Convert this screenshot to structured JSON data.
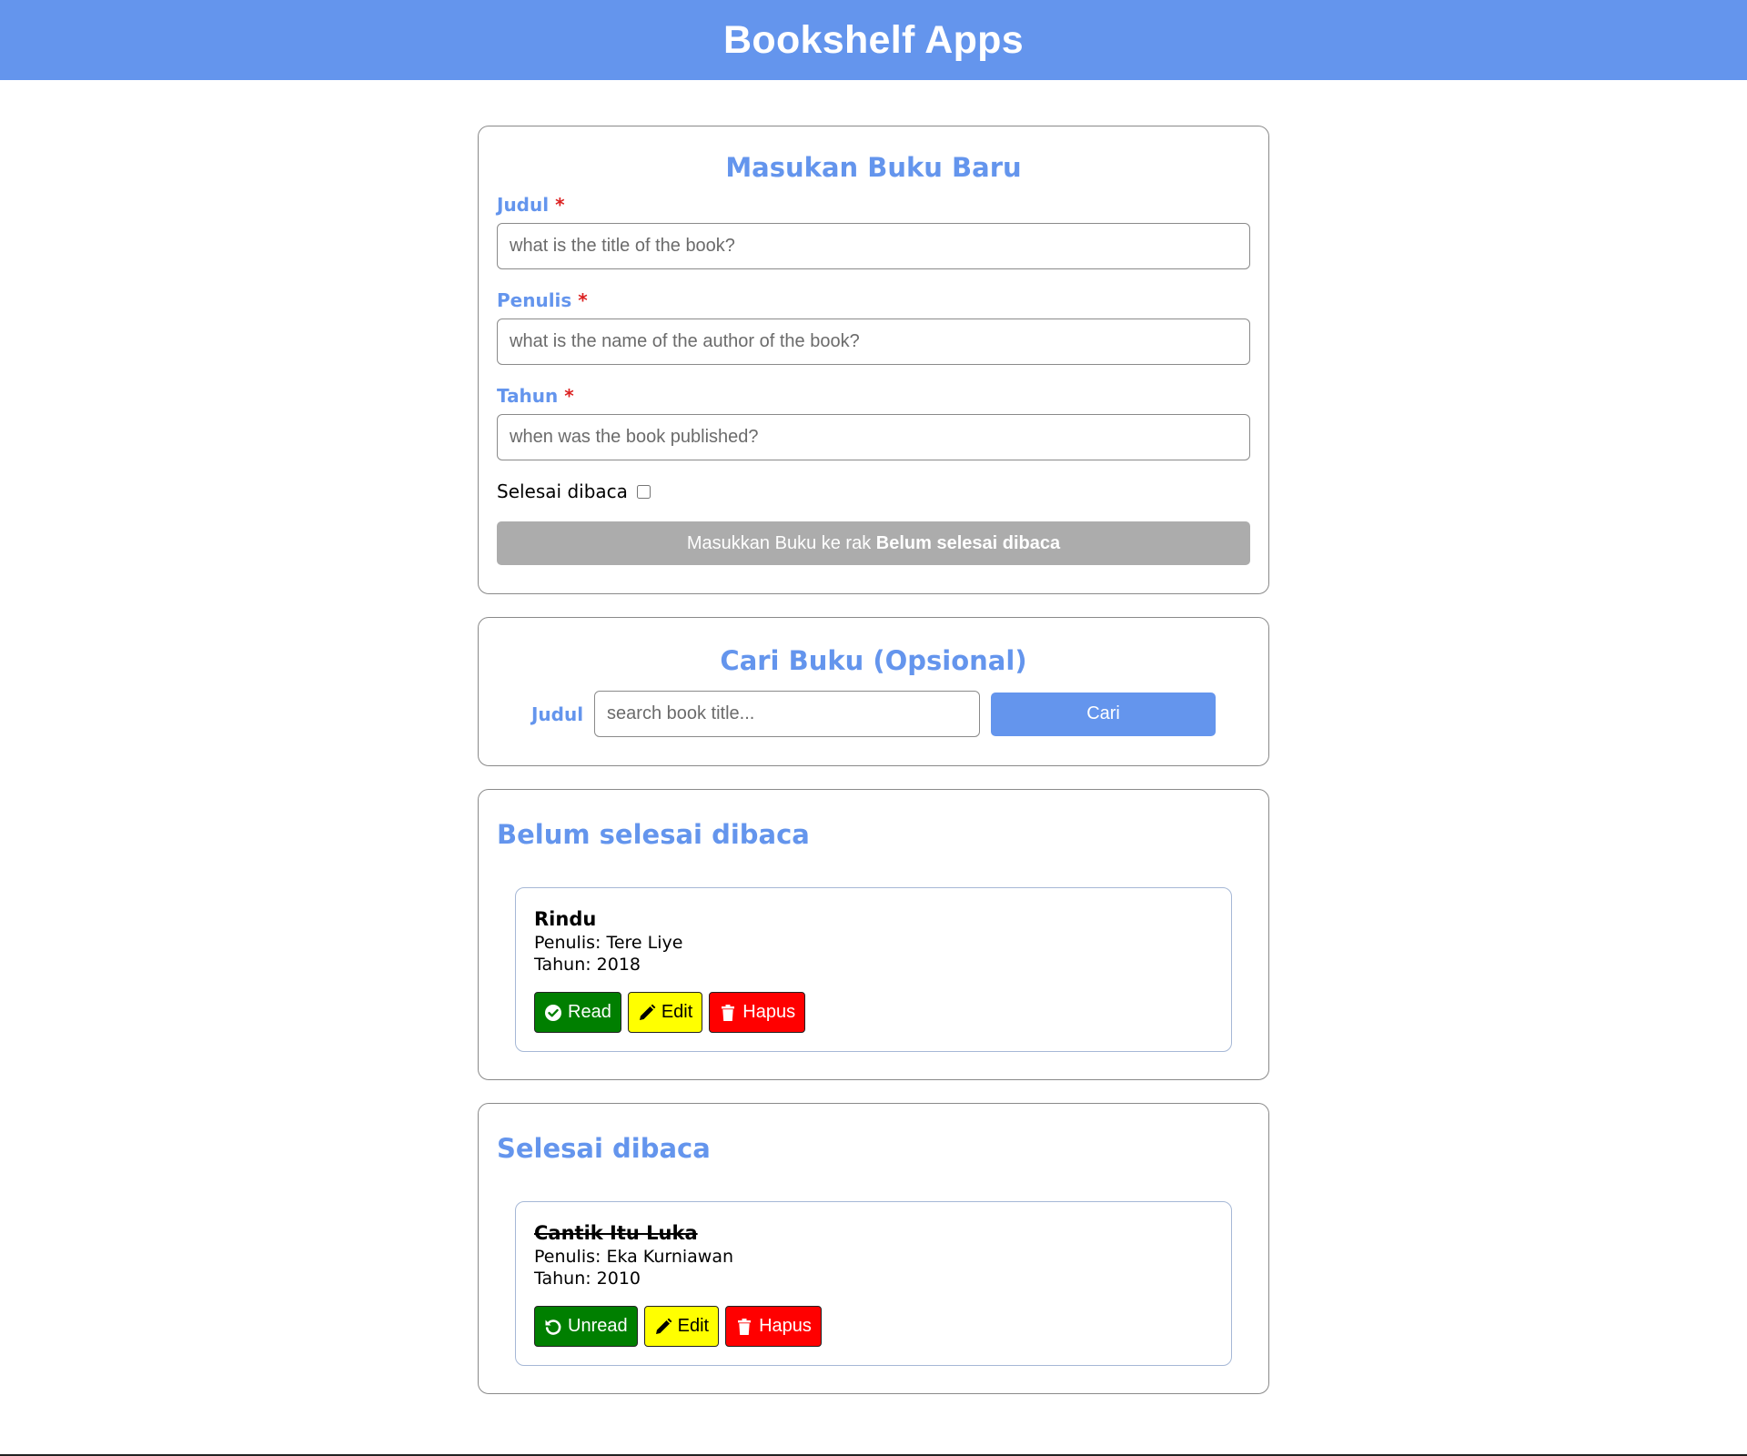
{
  "header": {
    "title": "Bookshelf Apps"
  },
  "input_form": {
    "title": "Masukan Buku Baru",
    "title_label": "Judul",
    "title_placeholder": "what is the title of the book?",
    "author_label": "Penulis",
    "author_placeholder": "what is the name of the author of the book?",
    "year_label": "Tahun",
    "year_placeholder": "when was the book published?",
    "required_mark": "*",
    "complete_label": "Selesai dibaca",
    "complete_checked": false,
    "submit_prefix": "Masukkan Buku ke rak ",
    "submit_shelf": "Belum selesai dibaca"
  },
  "search": {
    "title": "Cari Buku (Opsional)",
    "label": "Judul",
    "placeholder": "search book title...",
    "button": "Cari"
  },
  "shelves": {
    "incomplete": {
      "title": "Belum selesai dibaca",
      "books": [
        {
          "title": "Rindu",
          "author": "Penulis: Tere Liye",
          "year": "Tahun: 2018",
          "toggle_label": "Read",
          "edit_label": "Edit",
          "delete_label": "Hapus"
        }
      ]
    },
    "complete": {
      "title": "Selesai dibaca",
      "books": [
        {
          "title": "Cantik Itu Luka",
          "author": "Penulis: Eka Kurniawan",
          "year": "Tahun: 2010",
          "toggle_label": "Unread",
          "edit_label": "Edit",
          "delete_label": "Hapus"
        }
      ]
    }
  },
  "colors": {
    "accent": "#6495ED",
    "required": "#dc2222",
    "read_button": "#007f00",
    "edit_button": "#ffff00",
    "delete_button": "#ff0000",
    "disabled_submit": "#acacac"
  },
  "icons": {
    "read": "check-circle-icon",
    "unread": "rotate-left-icon",
    "edit": "pencil-icon",
    "delete": "trash-icon"
  }
}
